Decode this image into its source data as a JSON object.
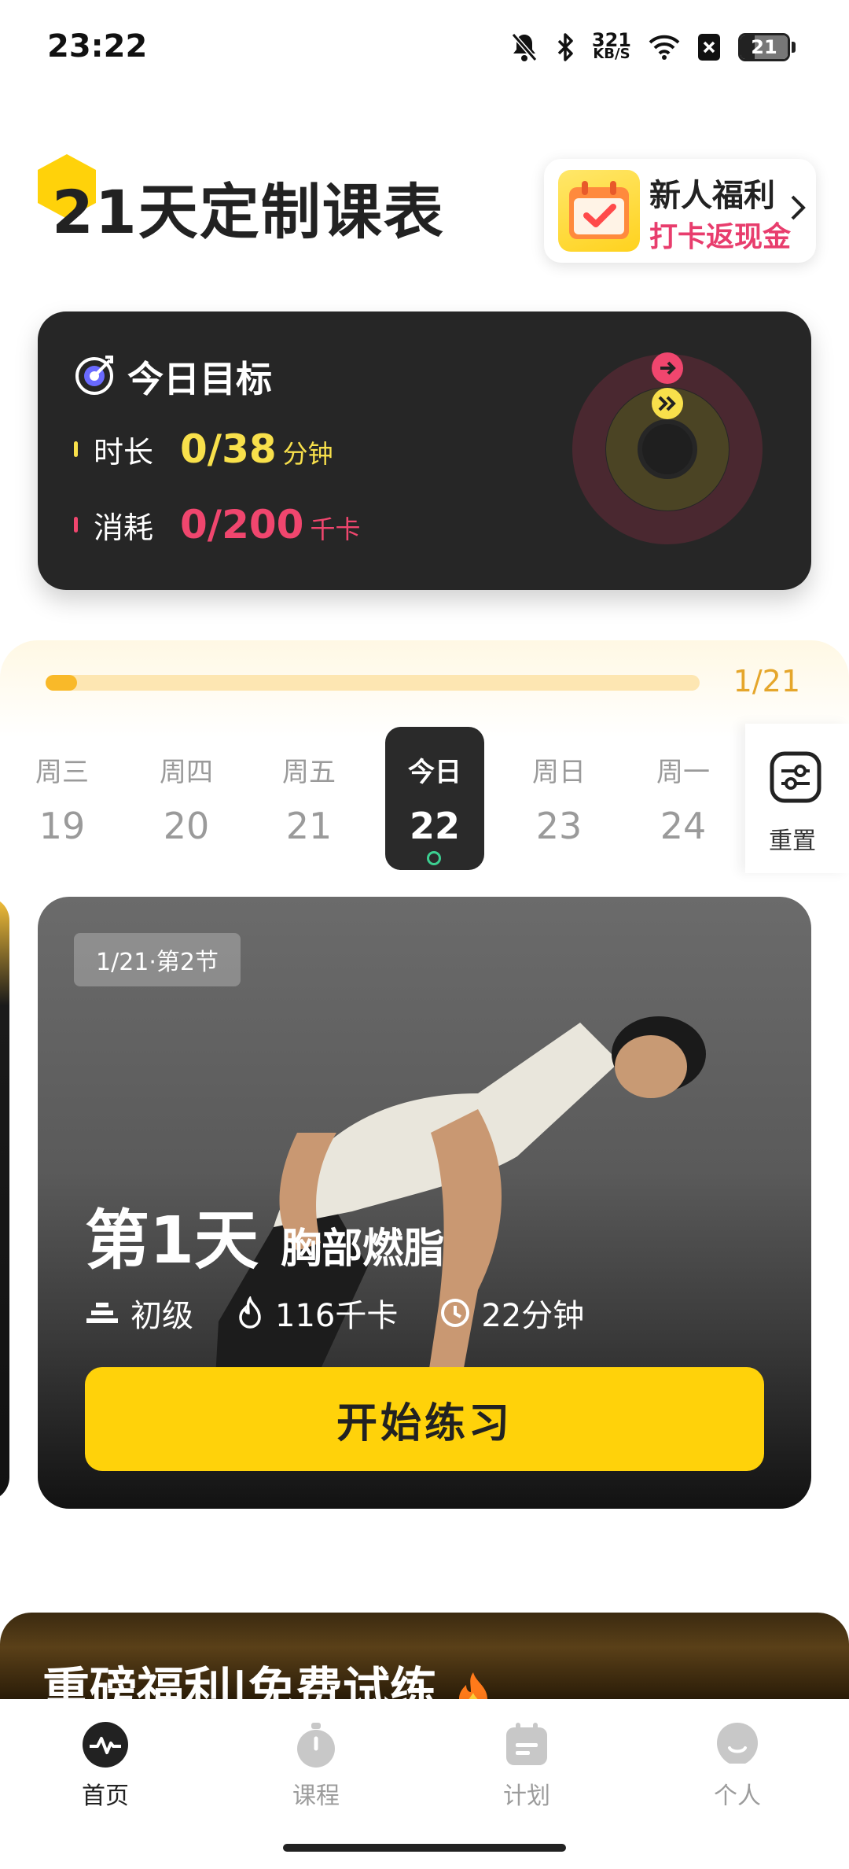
{
  "status_bar": {
    "time": "23:22",
    "net_speed_value": "321",
    "net_speed_unit": "KB/S",
    "battery_level": "21",
    "icons": [
      "mute-bell-icon",
      "bluetooth-icon",
      "wifi-icon",
      "sim-x-icon",
      "battery-icon"
    ]
  },
  "header": {
    "title": "21天定制课表",
    "promo": {
      "title": "新人福利",
      "subtitle": "打卡返现金"
    }
  },
  "goal_card": {
    "title": "今日目标",
    "duration": {
      "label": "时长",
      "value": "0/38",
      "unit": "分钟",
      "color": "#f8e04b"
    },
    "calories": {
      "label": "消耗",
      "value": "0/200",
      "unit": "千卡",
      "color": "#f0466e"
    }
  },
  "progress": {
    "count": "1/21",
    "fraction": 0.048
  },
  "calendar": {
    "days": [
      {
        "weekday": "周三",
        "date": "19"
      },
      {
        "weekday": "周四",
        "date": "20"
      },
      {
        "weekday": "周五",
        "date": "21"
      },
      {
        "weekday": "今日",
        "date": "22"
      },
      {
        "weekday": "周日",
        "date": "23"
      },
      {
        "weekday": "周一",
        "date": "24"
      }
    ],
    "reset_label": "重置"
  },
  "course": {
    "tag": "1/21·第2节",
    "day_title": "第1天",
    "name": "胸部燃脂",
    "level": "初级",
    "calories": "116千卡",
    "duration": "22分钟",
    "start_button": "开始练习"
  },
  "welfare": {
    "text": "重磅福利|免费试练"
  },
  "bottom_nav": {
    "items": [
      {
        "label": "首页",
        "icon": "pulse-icon"
      },
      {
        "label": "课程",
        "icon": "stopwatch-icon"
      },
      {
        "label": "计划",
        "icon": "calendar-icon"
      },
      {
        "label": "个人",
        "icon": "profile-icon"
      }
    ]
  },
  "colors": {
    "accent_yellow": "#ffd20a",
    "accent_pink": "#e83d6d",
    "dark_card": "#262626"
  }
}
